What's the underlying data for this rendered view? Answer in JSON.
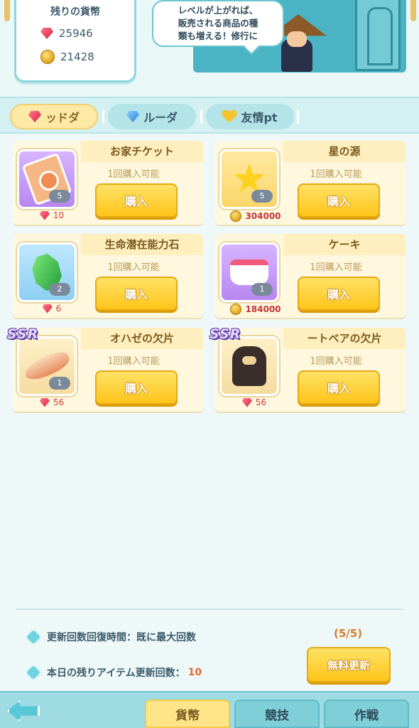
{
  "currency_panel": {
    "title": "残りの貨幣",
    "gems": "25946",
    "coins": "21428"
  },
  "npc": {
    "speech_lines": [
      "レベルが上がれば、",
      "販売される商品の種",
      "類も増える！修行に"
    ]
  },
  "tabs": [
    {
      "label": "ッドダ",
      "icon": "red-gem-icon",
      "active": true
    },
    {
      "label": "ルーダ",
      "icon": "blue-gem-icon",
      "active": false
    },
    {
      "label": "友情pt",
      "icon": "heart-icon",
      "active": false
    }
  ],
  "items": [
    {
      "name": "お家チケット",
      "limit": "1回購入可能",
      "buy": "購入",
      "qty": "5",
      "price": "10",
      "currency": "gem",
      "art": "ticket-icon",
      "ssr": ""
    },
    {
      "name": "星の源",
      "limit": "1回購入可能",
      "buy": "購入",
      "qty": "5",
      "price": "304000",
      "currency": "coin",
      "art": "star-icon",
      "ssr": ""
    },
    {
      "name": "生命潜在能力石",
      "limit": "1回購入可能",
      "buy": "購入",
      "qty": "2",
      "price": "6",
      "currency": "gem",
      "art": "emerald-icon",
      "ssr": ""
    },
    {
      "name": "ケーキ",
      "limit": "1回購入可能",
      "buy": "購入",
      "qty": "1",
      "price": "184000",
      "currency": "coin",
      "art": "cake-icon",
      "ssr": ""
    },
    {
      "name": "オハゼの欠片",
      "limit": "1回購入可能",
      "buy": "購入",
      "qty": "1",
      "price": "56",
      "currency": "gem",
      "art": "eel-icon",
      "ssr": "SSR"
    },
    {
      "name": "ートベアの欠片",
      "limit": "1回購入可能",
      "buy": "購入",
      "qty": "",
      "price": "56",
      "currency": "gem",
      "art": "bear-icon",
      "ssr": "SSR"
    }
  ],
  "refresh": {
    "recovery_label": "更新回数回復時間：既に最大回数",
    "remaining_label": "本日の残りアイテム更新回数：",
    "remaining_value": "10",
    "count": "(5/5)",
    "button": "無料更新"
  },
  "bottom_nav": {
    "back_icon": "back-arrow-icon",
    "tabs": [
      {
        "label": "貨幣",
        "active": true
      },
      {
        "label": "競技",
        "active": false
      },
      {
        "label": "作戦",
        "active": false
      }
    ]
  },
  "colors": {
    "accent_yellow": "#ffc51a",
    "teal": "#4ab4c4",
    "price_red": "#d23a40"
  }
}
